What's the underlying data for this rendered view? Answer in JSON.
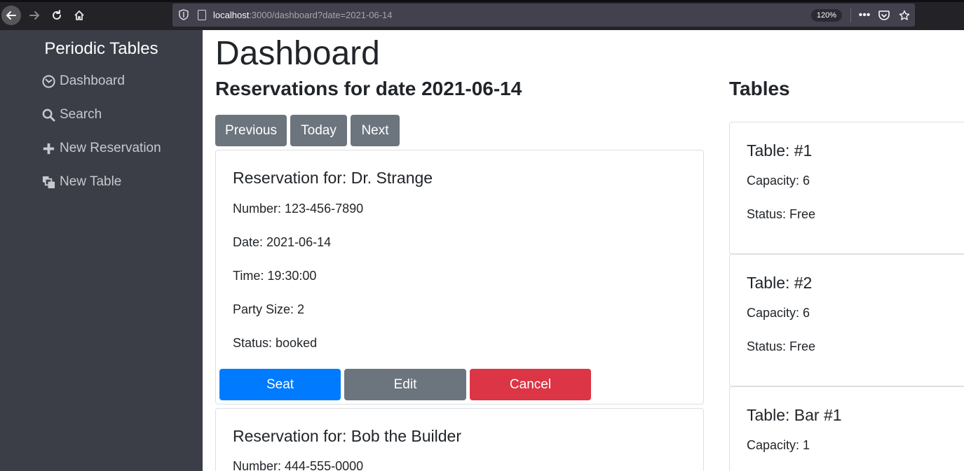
{
  "browser": {
    "url_host": "localhost",
    "url_rest": ":3000/dashboard?date=2021-06-14",
    "zoom": "120%"
  },
  "sidebar": {
    "brand": "Periodic Tables",
    "items": [
      {
        "label": "Dashboard",
        "icon": "dashboard-icon"
      },
      {
        "label": "Search",
        "icon": "search-icon"
      },
      {
        "label": "New Reservation",
        "icon": "plus-icon"
      },
      {
        "label": "New Table",
        "icon": "layers-icon"
      }
    ]
  },
  "main": {
    "title": "Dashboard",
    "subtitle": "Reservations for date 2021-06-14",
    "tables_title": "Tables",
    "nav_buttons": {
      "previous": "Previous",
      "today": "Today",
      "next": "Next"
    }
  },
  "reservations": [
    {
      "title": "Reservation for: Dr. Strange",
      "number": "Number: 123-456-7890",
      "date": "Date: 2021-06-14",
      "time": "Time: 19:30:00",
      "party_size": "Party Size: 2",
      "status": "Status: booked",
      "actions": {
        "seat": "Seat",
        "edit": "Edit",
        "cancel": "Cancel"
      }
    },
    {
      "title": "Reservation for: Bob the Builder",
      "number": "Number: 444-555-0000"
    }
  ],
  "tables": [
    {
      "title": "Table: #1",
      "capacity": "Capacity: 6",
      "status": "Status: Free"
    },
    {
      "title": "Table: #2",
      "capacity": "Capacity: 6",
      "status": "Status: Free"
    },
    {
      "title": "Table: Bar #1",
      "capacity": "Capacity: 1"
    }
  ],
  "colors": {
    "primary": "#007bff",
    "secondary": "#6c757d",
    "danger": "#dc3545",
    "sidebar": "#3b3d47"
  }
}
